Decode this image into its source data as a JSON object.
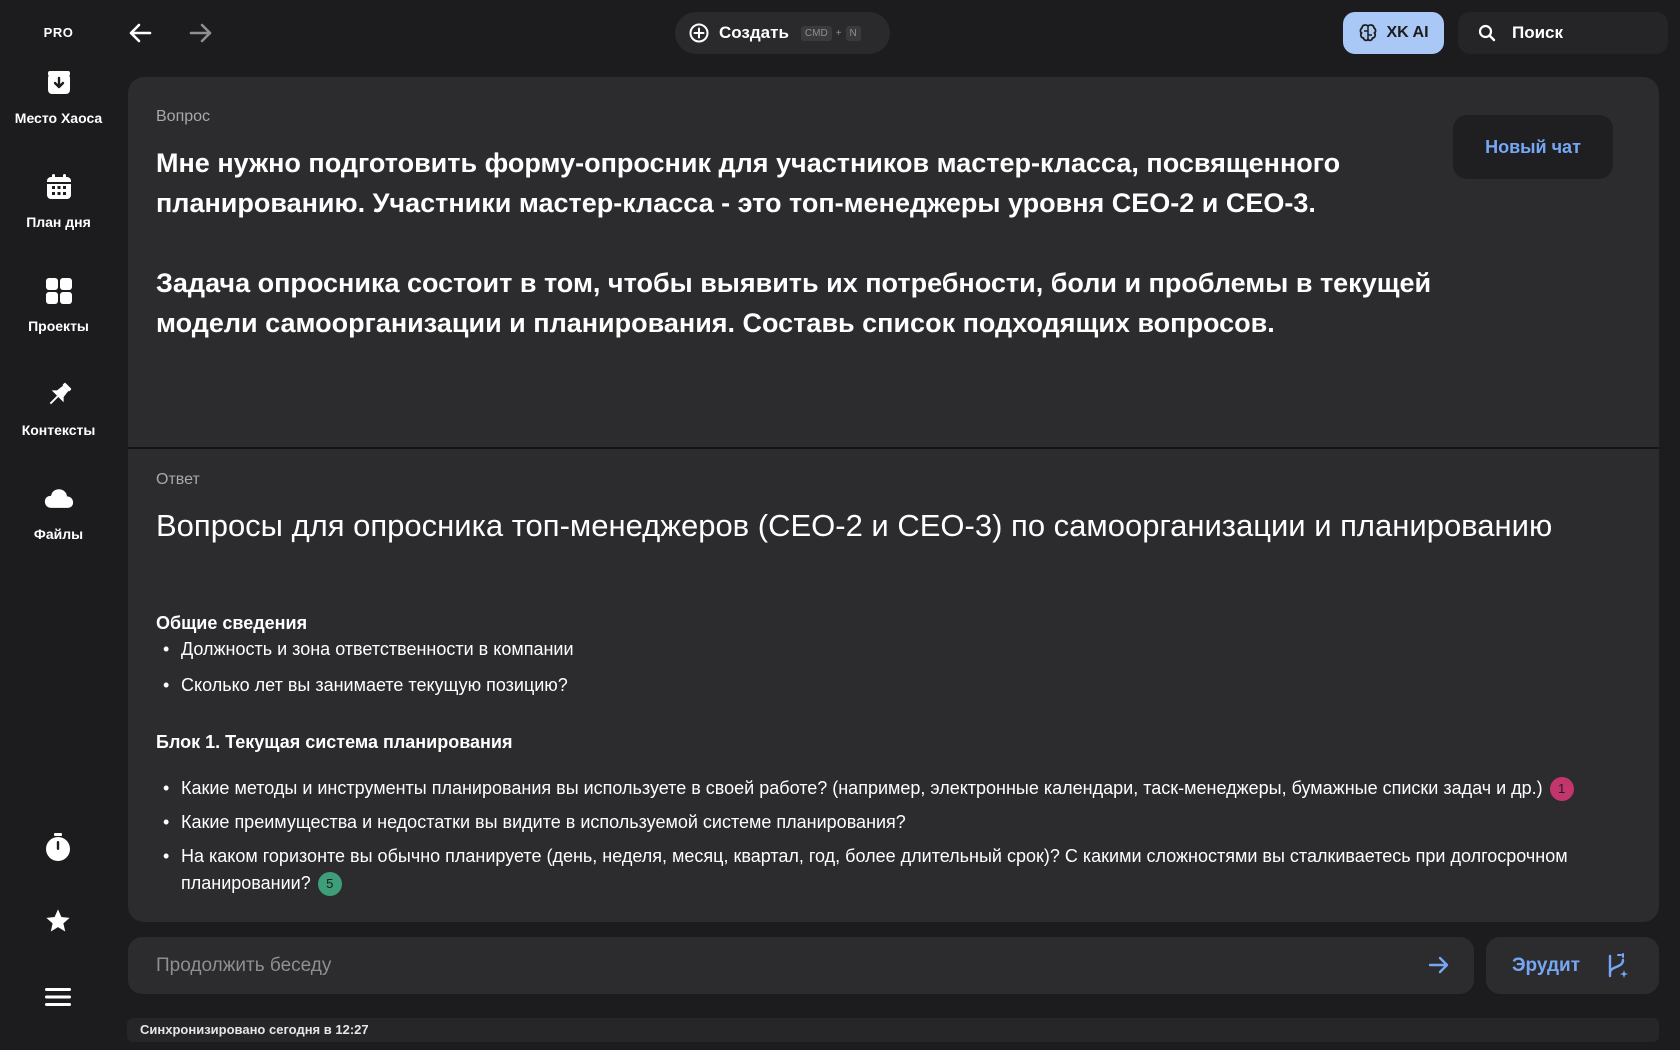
{
  "sidebar": {
    "badge": "PRO",
    "items": [
      {
        "label": "Место Хаоса",
        "icon": "inbox-download-icon"
      },
      {
        "label": "План дня",
        "icon": "calendar-icon"
      },
      {
        "label": "Проекты",
        "icon": "grid-icon"
      },
      {
        "label": "Контексты",
        "icon": "pin-icon"
      },
      {
        "label": "Файлы",
        "icon": "cloud-icon"
      }
    ],
    "bottom": [
      "timer-icon",
      "star-icon",
      "menu-icon"
    ]
  },
  "topbar": {
    "create_label": "Создать",
    "shortcut_key1": "CMD",
    "shortcut_plus": "+",
    "shortcut_key2": "N",
    "ai_label": "XK AI",
    "search_label": "Поиск"
  },
  "question": {
    "label": "Вопрос",
    "paragraph1": "Мне нужно подготовить форму-опросник для участников мастер-класса, посвященного планированию. Участники мастер-класса - это топ-менеджеры уровня CEO-2 и CEO-3.",
    "paragraph2": "Задача опросника состоит в том, чтобы выявить их потребности, боли и проблемы в текущей модели самоорганизации и планирования. Составь список подходящих вопросов.",
    "new_chat_label": "Новый чат"
  },
  "answer": {
    "label": "Ответ",
    "title": "Вопросы для опросника топ-менеджеров (CEO-2 и CEO-3) по самоорганизации и планированию",
    "section1": {
      "heading": "Общие сведения",
      "items": [
        "Должность и зона ответственности в компании",
        "Сколько лет вы занимаете текущую позицию?"
      ]
    },
    "section2": {
      "heading": "Блок 1. Текущая система планирования",
      "items": [
        {
          "text": "Какие методы и инструменты планирования вы используете в своей работе? (например, электронные календари, таск-менеджеры, бумажные списки задач и др.)",
          "badge": "1",
          "badge_color": "#c2366d"
        },
        {
          "text": "Какие преимущества и недостатки вы видите в используемой системе планирования?",
          "badge": "",
          "badge_color": ""
        },
        {
          "text": "На каком горизонте вы обычно планируете (день, неделя, месяц, квартал, год, более длительный срок)? С какими сложностями вы сталкиваетесь при долгосрочном планировании?",
          "badge": "5",
          "badge_color": "#3f9e7a"
        }
      ]
    }
  },
  "chat": {
    "placeholder": "Продолжить беседу",
    "erudit_label": "Эрудит"
  },
  "status": "Синхронизировано сегодня в 12:27",
  "colors": {
    "background": "#1c1c1e",
    "panel": "#2c2c2e",
    "accent": "#76a7f5",
    "ai_button": "#a9c8f5"
  }
}
